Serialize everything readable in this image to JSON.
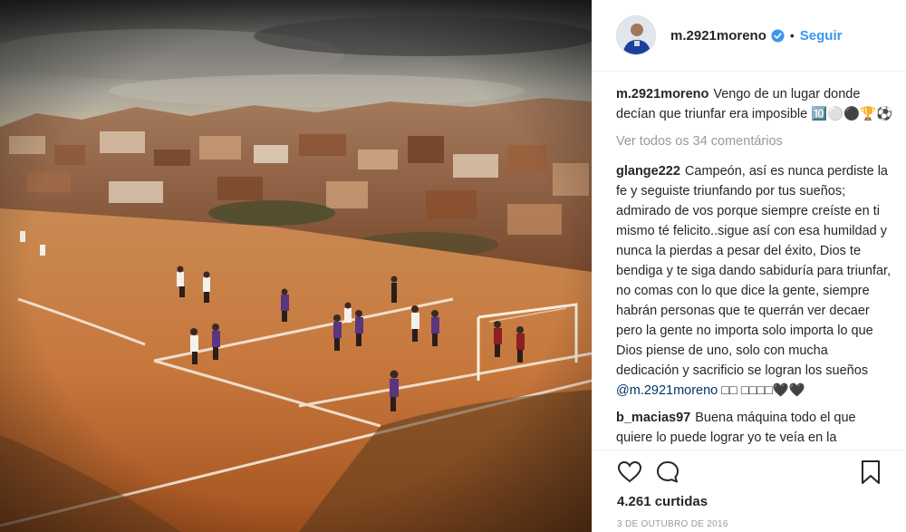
{
  "post": {
    "author": "m.2921moreno",
    "follow_label": "Seguir",
    "separator": "•"
  },
  "caption": {
    "user": "m.2921moreno",
    "text": "Vengo de un lugar donde decían que triunfar era imposible 🔟⚪⚫🏆⚽"
  },
  "view_all_comments": "Ver todos os 34 comentários",
  "comments": [
    {
      "user": "glange222",
      "text": "Campeón, así es nunca perdiste la fe y seguiste triunfando por tus sueños; admirado de vos porque siempre creíste en ti mismo té felicito..sigue así con esa humildad y nunca la pierdas a pesar del éxito, Dios te bendiga y te siga dando sabiduría para triunfar, no comas con lo que dice la gente, siempre habrán personas que te querrán ver decaer pero la gente no importa solo importa lo que Dios piense de uno, solo con mucha dedicación y sacrificio se logran los sueños",
      "mention": "@m.2921moreno",
      "suffix": " □□ □□□□🖤🖤"
    },
    {
      "user": "b_macias97",
      "text": "Buena máquina todo el que quiere lo puede lograr yo te veía en la"
    }
  ],
  "likes": "4.261 curtidas",
  "date": "3 DE OUTUBRO DE 2016",
  "icons": {
    "like": "heart-icon",
    "comment": "comment-bubble-icon",
    "save": "bookmark-icon",
    "verified": "verified-badge-icon"
  },
  "colors": {
    "link": "#3897f0",
    "mention": "#003569",
    "muted": "#999999",
    "verified": "#3897f0"
  }
}
